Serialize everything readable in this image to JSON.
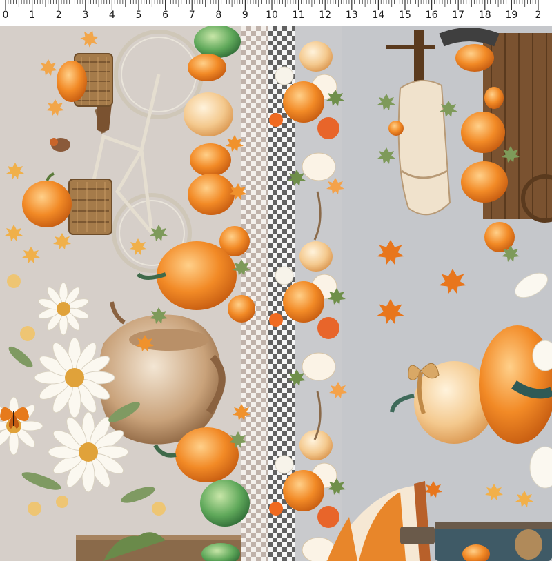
{
  "ruler": {
    "labels": [
      "0",
      "1",
      "2",
      "3",
      "4",
      "5",
      "6",
      "7",
      "8",
      "9",
      "10",
      "11",
      "12",
      "13",
      "14",
      "15",
      "16",
      "17",
      "18",
      "19",
      "2"
    ]
  },
  "colors": {
    "left_panel": "#d6cfc9",
    "right_panel": "#c5c7cb",
    "pumpkin_orange": "#f08a24",
    "pumpkin_light": "#f6c07a",
    "pumpkin_green": "#5fa85a",
    "gingham_taupe": "#96807a",
    "gingham_black": "#282828",
    "wood": "#7a5230"
  },
  "motifs": [
    "bicycle-illustration",
    "wicker-basket-icon",
    "pumpkin-illustration",
    "daisy-flower-illustration",
    "butterfly-illustration",
    "clay-pitcher-illustration",
    "gingham-stripe",
    "wooden-cart-illustration",
    "maple-leaf-icon",
    "ribbon-bow-illustration",
    "striped-tent-illustration"
  ]
}
